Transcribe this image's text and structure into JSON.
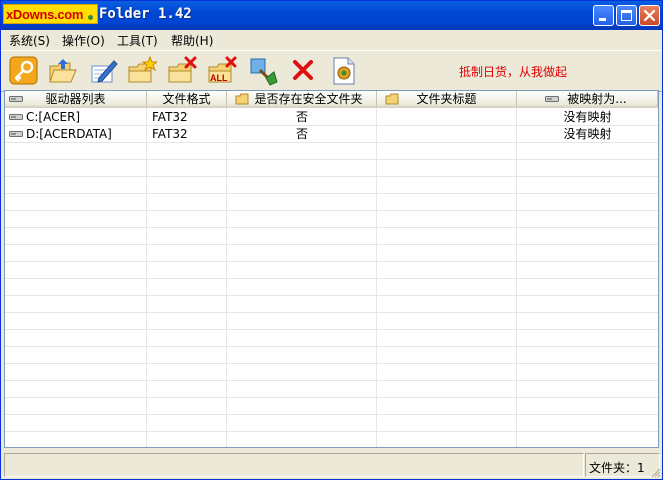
{
  "titlebar": {
    "logo_text": "xDowns.com",
    "title": "Folder 1.42"
  },
  "menu": [
    {
      "label": "系统(S)"
    },
    {
      "label": "操作(O)"
    },
    {
      "label": "工具(T)"
    },
    {
      "label": "帮助(H)"
    }
  ],
  "toolbar": {
    "slogan": "抵制日货，从我做起",
    "tools": [
      {
        "icon": "key-icon"
      },
      {
        "icon": "folder-open-icon"
      },
      {
        "icon": "edit-pen-icon"
      },
      {
        "icon": "folder-new-icon"
      },
      {
        "icon": "folder-delete-icon"
      },
      {
        "icon": "folder-delete-all-icon"
      },
      {
        "icon": "broom-clean-icon"
      },
      {
        "icon": "red-x-icon"
      },
      {
        "icon": "document-gear-icon"
      }
    ],
    "all_badge": "ALL"
  },
  "table": {
    "columns": [
      {
        "label": "驱动器列表",
        "icon": "drive-icon"
      },
      {
        "label": "文件格式",
        "icon": ""
      },
      {
        "label": "是否存在安全文件夹",
        "icon": "folder-icon"
      },
      {
        "label": "文件夹标题",
        "icon": "folder-icon"
      },
      {
        "label": "被映射为...",
        "icon": "drive-icon"
      }
    ],
    "rows": [
      {
        "drive": "C:[ACER]",
        "format": "FAT32",
        "secure": "否",
        "title": "",
        "mapped": "没有映射"
      },
      {
        "drive": "D:[ACERDATA]",
        "format": "FAT32",
        "secure": "否",
        "title": "",
        "mapped": "没有映射"
      }
    ]
  },
  "status": {
    "right": "文件夹：1"
  },
  "colors": {
    "title_blue": "#0046d5",
    "slogan_red": "#e00000",
    "window_bg": "#ece9d8"
  }
}
